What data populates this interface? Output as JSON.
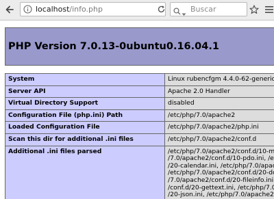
{
  "browser": {
    "url_host": "localhost",
    "url_path": "/info.php",
    "search_placeholder": "Buscar"
  },
  "page": {
    "title": "PHP Version 7.0.13-0ubuntu0.16.04.1",
    "rows": [
      {
        "label": "System",
        "value": "Linux rubencfgm 4.4.0-62-generic"
      },
      {
        "label": "Server API",
        "value": "Apache 2.0 Handler"
      },
      {
        "label": "Virtual Directory Support",
        "value": "disabled"
      },
      {
        "label": "Configuration File (php.ini) Path",
        "value": "/etc/php/7.0/apache2"
      },
      {
        "label": "Loaded Configuration File",
        "value": "/etc/php/7.0/apache2/php.ini"
      },
      {
        "label": "Scan this dir for additional .ini files",
        "value": "/etc/php/7.0/apache2/conf.d"
      },
      {
        "label": "Additional .ini files parsed",
        "lines": [
          "/etc/php/7.0/apache2/conf.d/10-my",
          "/7.0/apache2/conf.d/10-pdo.ini, /et",
          "/20-calendar.ini, /etc/php/7.0/apach",
          "/etc/php/7.0/apache2/conf.d/20-do",
          "/7.0/apache2/conf.d/20-fileinfo.ini,",
          "/conf.d/20-gettext.ini, /etc/php/7.0/",
          "/20-json.ini, /etc/php/7.0/apache2/c"
        ]
      }
    ]
  },
  "colors": {
    "header_bg": "#9999cc",
    "label_bg": "#ccccff",
    "value_bg": "#dddddd",
    "border": "#666666"
  }
}
